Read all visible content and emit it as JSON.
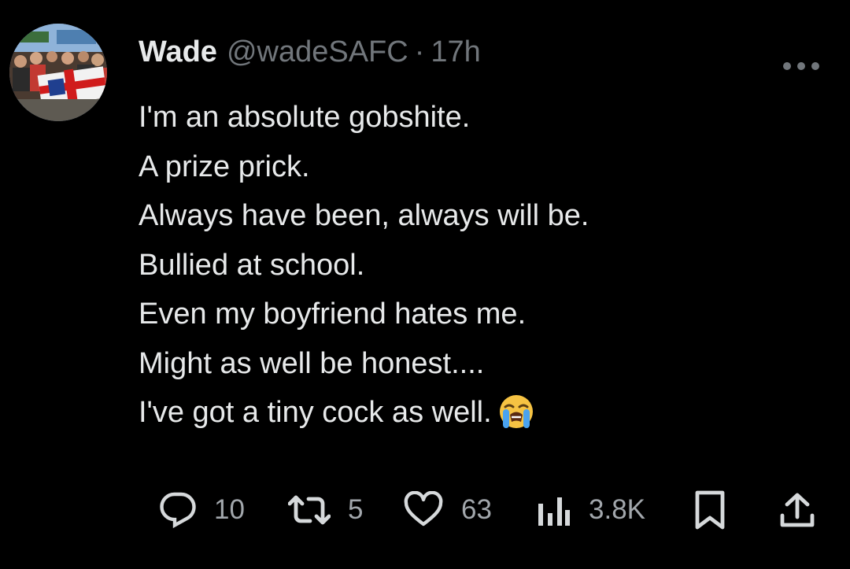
{
  "tweet": {
    "author": {
      "display_name": "Wade",
      "handle": "@wadeSAFC",
      "separator": "·",
      "time": "17h"
    },
    "text_lines": [
      "I'm an absolute gobshite.",
      "A prize prick.",
      "Always have been, always will be.",
      "Bullied at school.",
      "Even my boyfriend hates me.",
      "Might as well be honest....",
      "I've got a tiny cock as well."
    ],
    "emoji": "loudly-crying-face",
    "more_icon": "more-horizontal-icon"
  },
  "actions": {
    "replies": "10",
    "reposts": "5",
    "likes": "63",
    "views": "3.8K"
  },
  "colors": {
    "background": "#000000",
    "text": "#e7e9ea",
    "secondary": "#71767b"
  }
}
